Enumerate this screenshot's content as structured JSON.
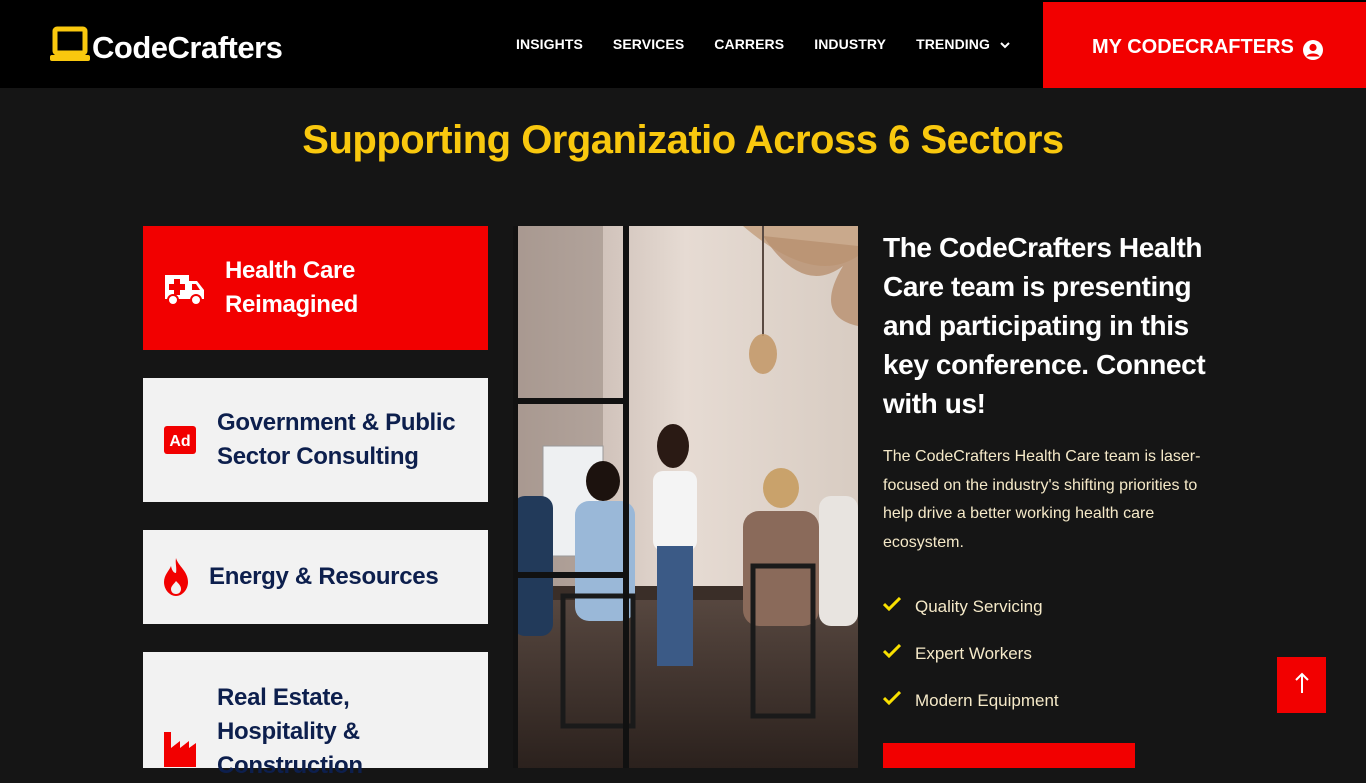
{
  "brand": {
    "name": "CodeCrafters",
    "logo_icon": "laptop-icon",
    "accent": "#f9c80e"
  },
  "nav": {
    "items": [
      {
        "label": "INSIGHTS"
      },
      {
        "label": "SERVICES"
      },
      {
        "label": "CARRERS"
      },
      {
        "label": "INDUSTRY"
      },
      {
        "label": "TRENDING",
        "icon": "chevron-down-icon"
      }
    ],
    "cta": {
      "label": "MY CODECRAFTERS",
      "icon": "user-circle-icon",
      "color": "#f20000"
    }
  },
  "section": {
    "title": "Supporting Organizatio Across 6 Sectors"
  },
  "sectors": [
    {
      "label_line1": "Health Care",
      "label_line2": "Reimagined",
      "icon": "ambulance-icon",
      "active": true
    },
    {
      "label_line1": "Government & Public",
      "label_line2": "Sector Consulting",
      "icon": "ad-icon",
      "active": false
    },
    {
      "label_line1": "Energy & Resources",
      "icon": "flame-icon",
      "active": false
    },
    {
      "label_line1": "Real Estate,",
      "label_line2": "Hospitality &",
      "label_line3": "Construction",
      "icon": "factory-icon",
      "active": false
    }
  ],
  "detail": {
    "title": "The CodeCrafters Health Care team is presenting and participating in this key conference. Connect with us!",
    "description": "The CodeCrafters Health Care team is laser-focused on the industry's shifting priorities to help drive a better working health care ecosystem.",
    "features": [
      {
        "label": "Quality Servicing",
        "icon": "check-icon"
      },
      {
        "label": "Expert Workers",
        "icon": "check-icon"
      },
      {
        "label": "Modern Equipment",
        "icon": "check-icon"
      }
    ]
  },
  "scroll_top": {
    "icon": "arrow-up-icon"
  }
}
